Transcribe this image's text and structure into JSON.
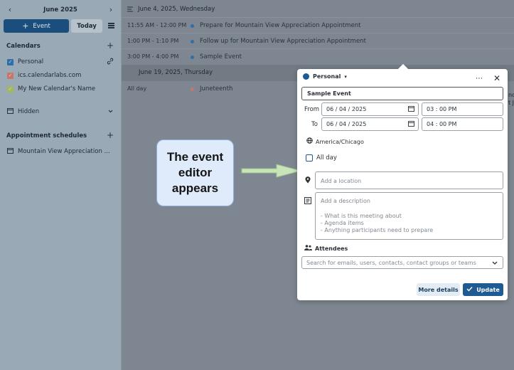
{
  "sidebar": {
    "month": "June 2025",
    "prev": "‹",
    "next": "›",
    "event_btn": "Event",
    "today_btn": "Today",
    "calendars_heading": "Calendars",
    "calendars": [
      {
        "label": "Personal",
        "color": "#2f6fa8"
      },
      {
        "label": "ics.calendarlabs.com",
        "color": "#c7776a"
      },
      {
        "label": "My New Calendar's Name",
        "color": "#a6b85d"
      }
    ],
    "hidden_label": "Hidden",
    "appointments_heading": "Appointment schedules",
    "appointment_item": "Mountain View Appreciation ..."
  },
  "agenda": {
    "day1": "June 4, 2025, Wednesday",
    "events": [
      {
        "time": "11:55 AM - 12:00 PM",
        "title": "Prepare for Mountain View Appreciation Appointment"
      },
      {
        "time": "1:00 PM - 1:10 PM",
        "title": "Follow up for Mountain View Appreciation Appointment"
      },
      {
        "time": "3:00 PM - 4:00 PM",
        "title": "Sample Event"
      }
    ],
    "day2": "June 19, 2025, Thursday",
    "allday_time": "All day",
    "allday_title": "Juneteenth",
    "edge_text_1": "nd",
    "edge_text_2": "t J"
  },
  "callout": {
    "text": "The event editor appears"
  },
  "editor": {
    "calendar": "Personal",
    "title_value": "Sample Event",
    "from_label": "From",
    "to_label": "To",
    "from_date": "06 / 04 / 2025",
    "from_time": "03 : 00  PM",
    "to_date": "06 / 04 / 2025",
    "to_time": "04 : 00  PM",
    "timezone": "America/Chicago",
    "allday_label": "All day",
    "location_placeholder": "Add a location",
    "description_placeholder": "Add a description",
    "description_hints": [
      "- What is this meeting about",
      "- Agenda items",
      "- Anything participants need to prepare"
    ],
    "attendees_label": "Attendees",
    "attendees_placeholder": "Search for emails, users, contacts, contact groups or teams",
    "more_details": "More details",
    "update": "Update"
  },
  "colors": {
    "accent": "#1f5a93",
    "sidebar_bg": "#9aa9b6",
    "dim_bg": "#7e8791"
  }
}
